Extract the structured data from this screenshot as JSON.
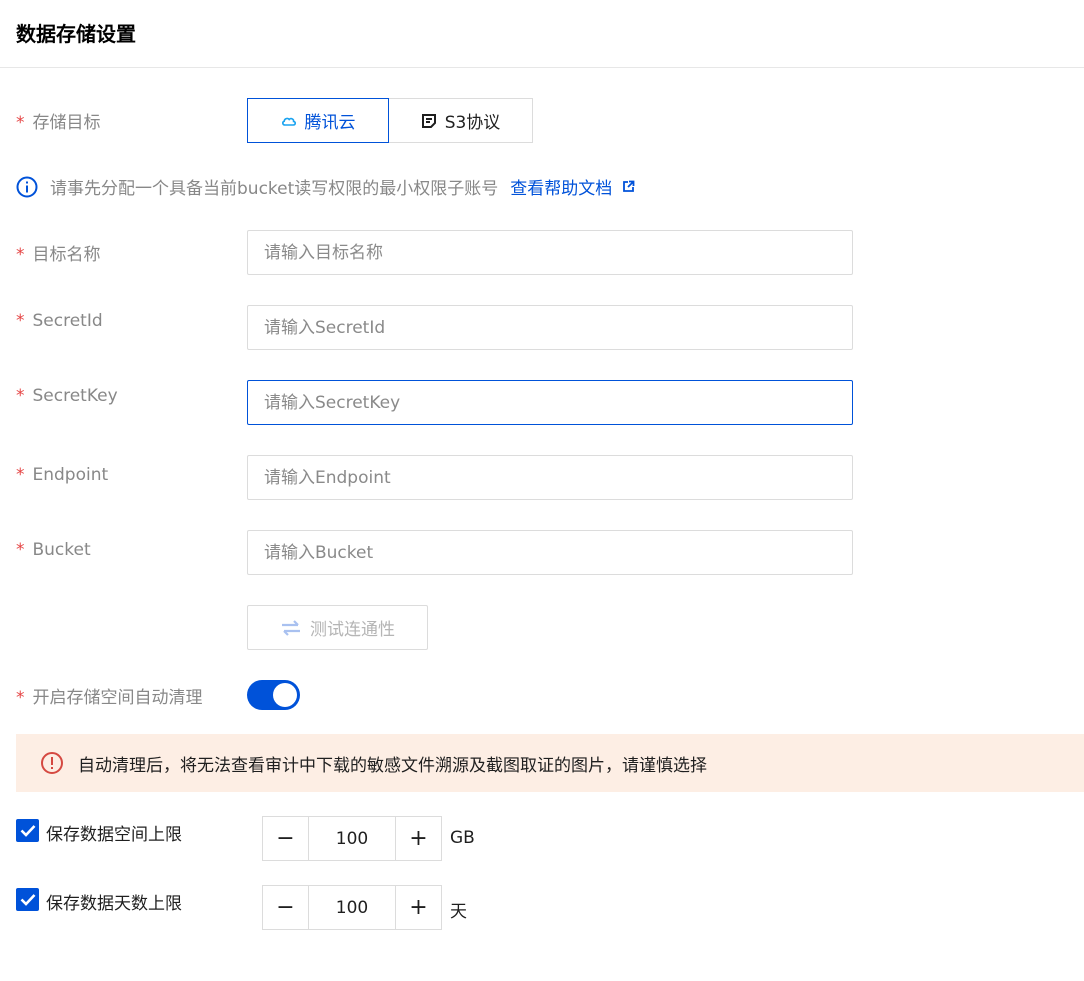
{
  "page": {
    "title": "数据存储设置"
  },
  "storage_target": {
    "label": "存储目标",
    "options": [
      {
        "label": "腾讯云",
        "icon": "cloud-icon",
        "selected": true
      },
      {
        "label": "S3协议",
        "icon": "document-icon",
        "selected": false
      }
    ]
  },
  "info": {
    "text": "请事先分配一个具备当前bucket读写权限的最小权限子账号",
    "link_label": "查看帮助文档"
  },
  "fields": [
    {
      "label": "目标名称",
      "placeholder": "请输入目标名称",
      "value": ""
    },
    {
      "label": "SecretId",
      "placeholder": "请输入SecretId",
      "value": ""
    },
    {
      "label": "SecretKey",
      "placeholder": "请输入SecretKey",
      "value": ""
    },
    {
      "label": "Endpoint",
      "placeholder": "请输入Endpoint",
      "value": ""
    },
    {
      "label": "Bucket",
      "placeholder": "请输入Bucket",
      "value": ""
    }
  ],
  "test_button": {
    "label": "测试连通性"
  },
  "auto_clean": {
    "label": "开启存储空间自动清理",
    "enabled": true
  },
  "warning": {
    "text": "自动清理后，将无法查看审计中下载的敏感文件溯源及截图取证的图片，请谨慎选择"
  },
  "limits": [
    {
      "label": "保存数据空间上限",
      "checked": true,
      "value": "100",
      "unit": "GB",
      "minus": "−",
      "plus": "+"
    },
    {
      "label": "保存数据天数上限",
      "checked": true,
      "value": "100",
      "unit": "天",
      "minus": "−",
      "plus": "+"
    }
  ],
  "colors": {
    "primary": "#0052d9",
    "required": "#e54545",
    "warning_bg": "#fdeee4",
    "warning_icon": "#d54941"
  }
}
